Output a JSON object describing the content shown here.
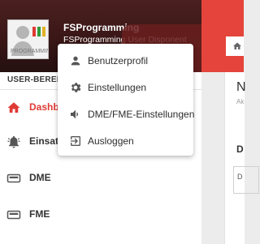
{
  "header": {
    "app_name": "FSProgramming",
    "user_display": "FSProgramming User Disponent",
    "avatar_logo_text": "PROGRAMMING FS"
  },
  "sidebar": {
    "section_label": "USER-BEREICH",
    "items": [
      {
        "label": "Dashboard",
        "icon": "home-icon",
        "active": true
      },
      {
        "label": "Einsatz",
        "icon": "alarm-bell-icon",
        "active": false
      },
      {
        "label": "DME",
        "icon": "pager-icon",
        "active": false
      },
      {
        "label": "FME",
        "icon": "pager-icon",
        "active": false
      }
    ]
  },
  "user_menu": {
    "items": [
      {
        "label": "Benutzerprofil",
        "icon": "person-icon"
      },
      {
        "label": "Einstellungen",
        "icon": "gear-icon"
      },
      {
        "label": "DME/FME-Einstellungen",
        "icon": "speaker-icon"
      },
      {
        "label": "Ausloggen",
        "icon": "logout-icon"
      }
    ]
  },
  "content": {
    "title": "N",
    "subtitle": "Ak",
    "section": "D",
    "field": "D"
  },
  "colors": {
    "accent": "#e03a35",
    "topbar": "#e4443b",
    "header_dark": "#3a1616"
  }
}
